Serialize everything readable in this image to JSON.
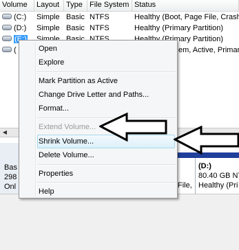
{
  "columns": [
    "Volume",
    "Layout",
    "Type",
    "File System",
    "Status"
  ],
  "rows": [
    {
      "volume": "(C:)",
      "layout": "Simple",
      "type": "Basic",
      "fs": "NTFS",
      "status": "Healthy (Boot, Page File, Crash D"
    },
    {
      "volume": "(D:)",
      "layout": "Simple",
      "type": "Basic",
      "fs": "NTFS",
      "status": "Healthy (Primary Partition)"
    },
    {
      "volume": "(E:)",
      "layout": "Simple",
      "type": "Basic",
      "fs": "NTFS",
      "status": "Healthy (Primary Partition)"
    },
    {
      "volume": "(",
      "layout": "",
      "type": "",
      "fs": "",
      "status": "em, Active, Primary"
    }
  ],
  "context_menu": {
    "items": [
      {
        "label": "Open",
        "enabled": true
      },
      {
        "label": "Explore",
        "enabled": true
      },
      {
        "label": "Mark Partition as Active",
        "enabled": true
      },
      {
        "label": "Change Drive Letter and Paths...",
        "enabled": true
      },
      {
        "label": "Format...",
        "enabled": true
      },
      {
        "label": "Extend Volume...",
        "enabled": false
      },
      {
        "label": "Shrink Volume...",
        "enabled": true,
        "highlighted": true
      },
      {
        "label": "Delete Volume...",
        "enabled": true
      },
      {
        "label": "Properties",
        "enabled": true
      },
      {
        "label": "Help",
        "enabled": true
      }
    ]
  },
  "disk_panel": {
    "label_lines": [
      "Bas",
      "298",
      "Onl"
    ],
    "partition_c_lines": [
      "File,"
    ],
    "partition_d": {
      "name": "(D:)",
      "size": "80.40 GB NT",
      "status": "Healthy (Pri"
    }
  },
  "arrows": [
    "arrow-to-extend-volume",
    "arrow-to-shrink-volume"
  ],
  "colors": {
    "selection": "#3399ff",
    "partition_bar": "#1f3f9b",
    "menu_highlight": "#dcf0fa"
  }
}
